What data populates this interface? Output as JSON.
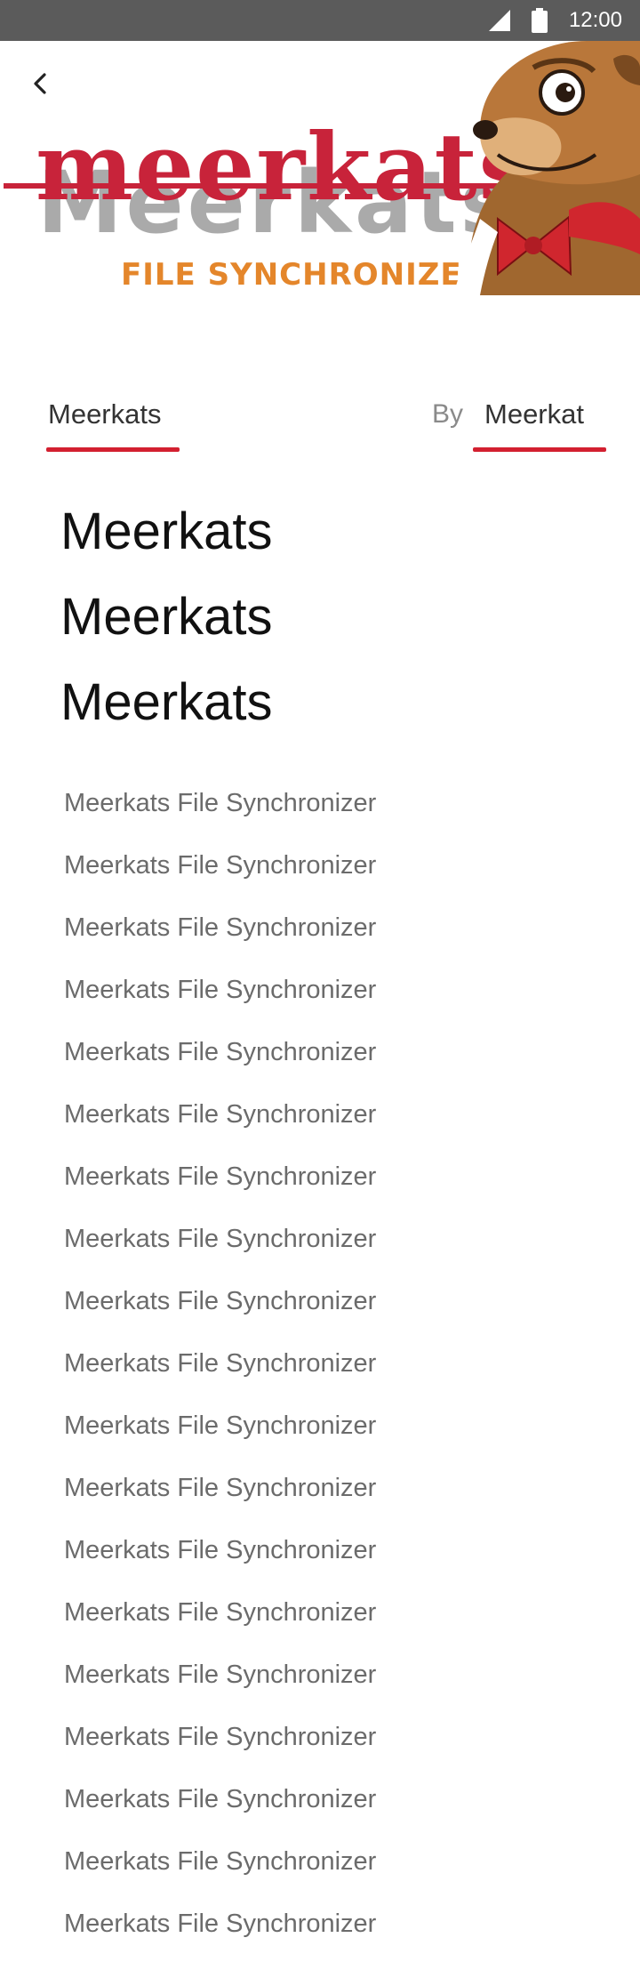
{
  "status_bar": {
    "time": "12:00",
    "icons": [
      "signal-icon",
      "battery-icon"
    ]
  },
  "banner": {
    "logo_text": "meerkats",
    "logo_shadow_text": "Meerkats",
    "tagline": "FILE SYNCHRONIZER",
    "colors": {
      "logo_red": "#c8233a",
      "tagline_orange": "#e4862b",
      "shadow_gray": "#9a9a9a"
    }
  },
  "nav": {
    "back_icon": "back-arrow-icon"
  },
  "meta": {
    "app_label": "Meerkats",
    "by_label": "By",
    "author_label": "Meerkat",
    "accent_color": "#d32030"
  },
  "title_lines": [
    "Meerkats",
    "Meerkats",
    "Meerkats"
  ],
  "description_lines": [
    "Meerkats File Synchronizer",
    "Meerkats File Synchronizer",
    "Meerkats File Synchronizer",
    "Meerkats File Synchronizer",
    "Meerkats File Synchronizer",
    "Meerkats File Synchronizer",
    "Meerkats File Synchronizer",
    "Meerkats File Synchronizer",
    "Meerkats File Synchronizer",
    "Meerkats File Synchronizer",
    "Meerkats File Synchronizer",
    "Meerkats File Synchronizer",
    "Meerkats File Synchronizer",
    "Meerkats File Synchronizer",
    "Meerkats File Synchronizer",
    "Meerkats File Synchronizer",
    "Meerkats File Synchronizer",
    "Meerkats File Synchronizer",
    "Meerkats File Synchronizer"
  ]
}
